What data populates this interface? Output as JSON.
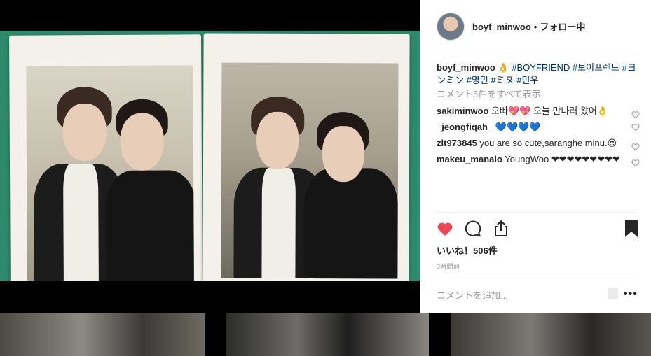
{
  "post": {
    "username": "boyf_minwoo",
    "separator": "•",
    "follow_status": "フォロー中",
    "caption": {
      "username": "boyf_minwoo",
      "emoji": "👌",
      "hashtags": [
        "#BOYFRIEND",
        "#보이프렌드",
        "#ヨンミン",
        "#영민",
        "#ミヌ",
        "#민우"
      ]
    },
    "view_all_comments": "コメント5件をすべて表示",
    "comments": [
      {
        "user": "sakiminwoo",
        "text": "오빠💖💖 오늘 만나러 왔어👌"
      },
      {
        "user": "_jeongfiqah_",
        "text": "💙💙💙💙"
      },
      {
        "user": "zit973845",
        "text": "you are so cute,saranghe minu.😍"
      },
      {
        "user": "makeu_manalo",
        "text": "YoungWoo ❤❤❤❤❤❤❤❤❤"
      }
    ],
    "likes_label": "いいね！506件",
    "timestamp": "3時間前",
    "add_comment_placeholder": "コメントを追加...",
    "more_label": "•••",
    "like_color": "#ed4956"
  },
  "icons": {
    "like": "heart-filled-icon",
    "comment": "comment-bubble-icon",
    "share": "share-icon",
    "save": "bookmark-filled-icon",
    "user_tag": "user-tag-icon",
    "small_heart": "heart-outline-icon"
  }
}
